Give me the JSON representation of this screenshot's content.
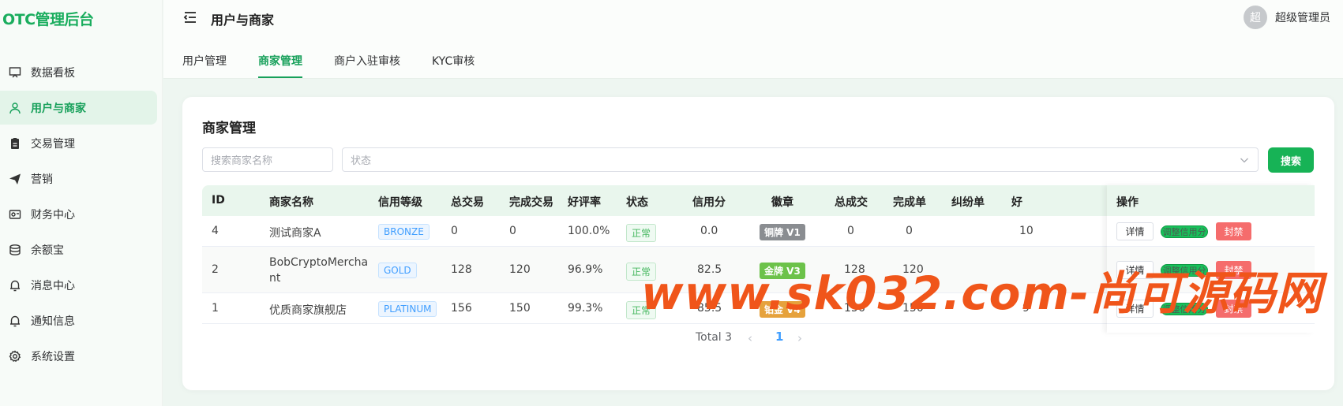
{
  "app": {
    "title": "OTC管理后台"
  },
  "sidebar": {
    "items": [
      {
        "label": "数据看板",
        "icon": "monitor-icon"
      },
      {
        "label": "用户与商家",
        "icon": "user-icon",
        "active": true
      },
      {
        "label": "交易管理",
        "icon": "clipboard-icon"
      },
      {
        "label": "营销",
        "icon": "send-icon"
      },
      {
        "label": "财务中心",
        "icon": "wallet-icon"
      },
      {
        "label": "余额宝",
        "icon": "coins-icon"
      },
      {
        "label": "消息中心",
        "icon": "bell-icon"
      },
      {
        "label": "通知信息",
        "icon": "bell-icon"
      },
      {
        "label": "系统设置",
        "icon": "gear-icon"
      }
    ]
  },
  "header": {
    "title": "用户与商家",
    "avatar_text": "超",
    "user_name": "超级管理员"
  },
  "tabs": [
    {
      "label": "用户管理"
    },
    {
      "label": "商家管理",
      "active": true
    },
    {
      "label": "商户入驻审核"
    },
    {
      "label": "KYC审核"
    }
  ],
  "main": {
    "title": "商家管理",
    "search_placeholder": "搜索商家名称",
    "status_placeholder": "状态",
    "search_button": "搜索"
  },
  "table": {
    "columns": [
      "ID",
      "商家名称",
      "信用等级",
      "总交易",
      "完成交易",
      "好评率",
      "状态",
      "信用分",
      "徽章",
      "总成交",
      "完成单",
      "纠纷单",
      "好",
      "操作"
    ],
    "rows": [
      {
        "id": "4",
        "name": "测试商家A",
        "level": "BRONZE",
        "total": "0",
        "done": "0",
        "rate": "100.0%",
        "status": "正常",
        "credit": "0.0",
        "badge": "铜牌 V1",
        "total_deal": "0",
        "done_order": "0",
        "dispute": "",
        "good": "10"
      },
      {
        "id": "2",
        "name": "BobCryptoMerchant",
        "level": "GOLD",
        "total": "128",
        "done": "120",
        "rate": "96.9%",
        "status": "正常",
        "credit": "82.5",
        "badge": "金牌 V3",
        "total_deal": "128",
        "done_order": "120",
        "dispute": "",
        "good": ""
      },
      {
        "id": "1",
        "name": "优质商家旗舰店",
        "level": "PLATINUM",
        "total": "156",
        "done": "150",
        "rate": "99.3%",
        "status": "正常",
        "credit": "85.5",
        "badge": "铂金 V4",
        "total_deal": "156",
        "done_order": "150",
        "dispute": "",
        "good": "9"
      }
    ],
    "actions": {
      "detail": "详情",
      "credit": "调整信用分",
      "ban": "封禁"
    }
  },
  "pagination": {
    "total": "Total 3",
    "current": "1"
  },
  "watermark": "www.sk032.com-尚可源码网",
  "colors": {
    "accent": "#17a05a",
    "primary_button": "#17b356",
    "danger": "#f56c6c",
    "link": "#409eff"
  }
}
